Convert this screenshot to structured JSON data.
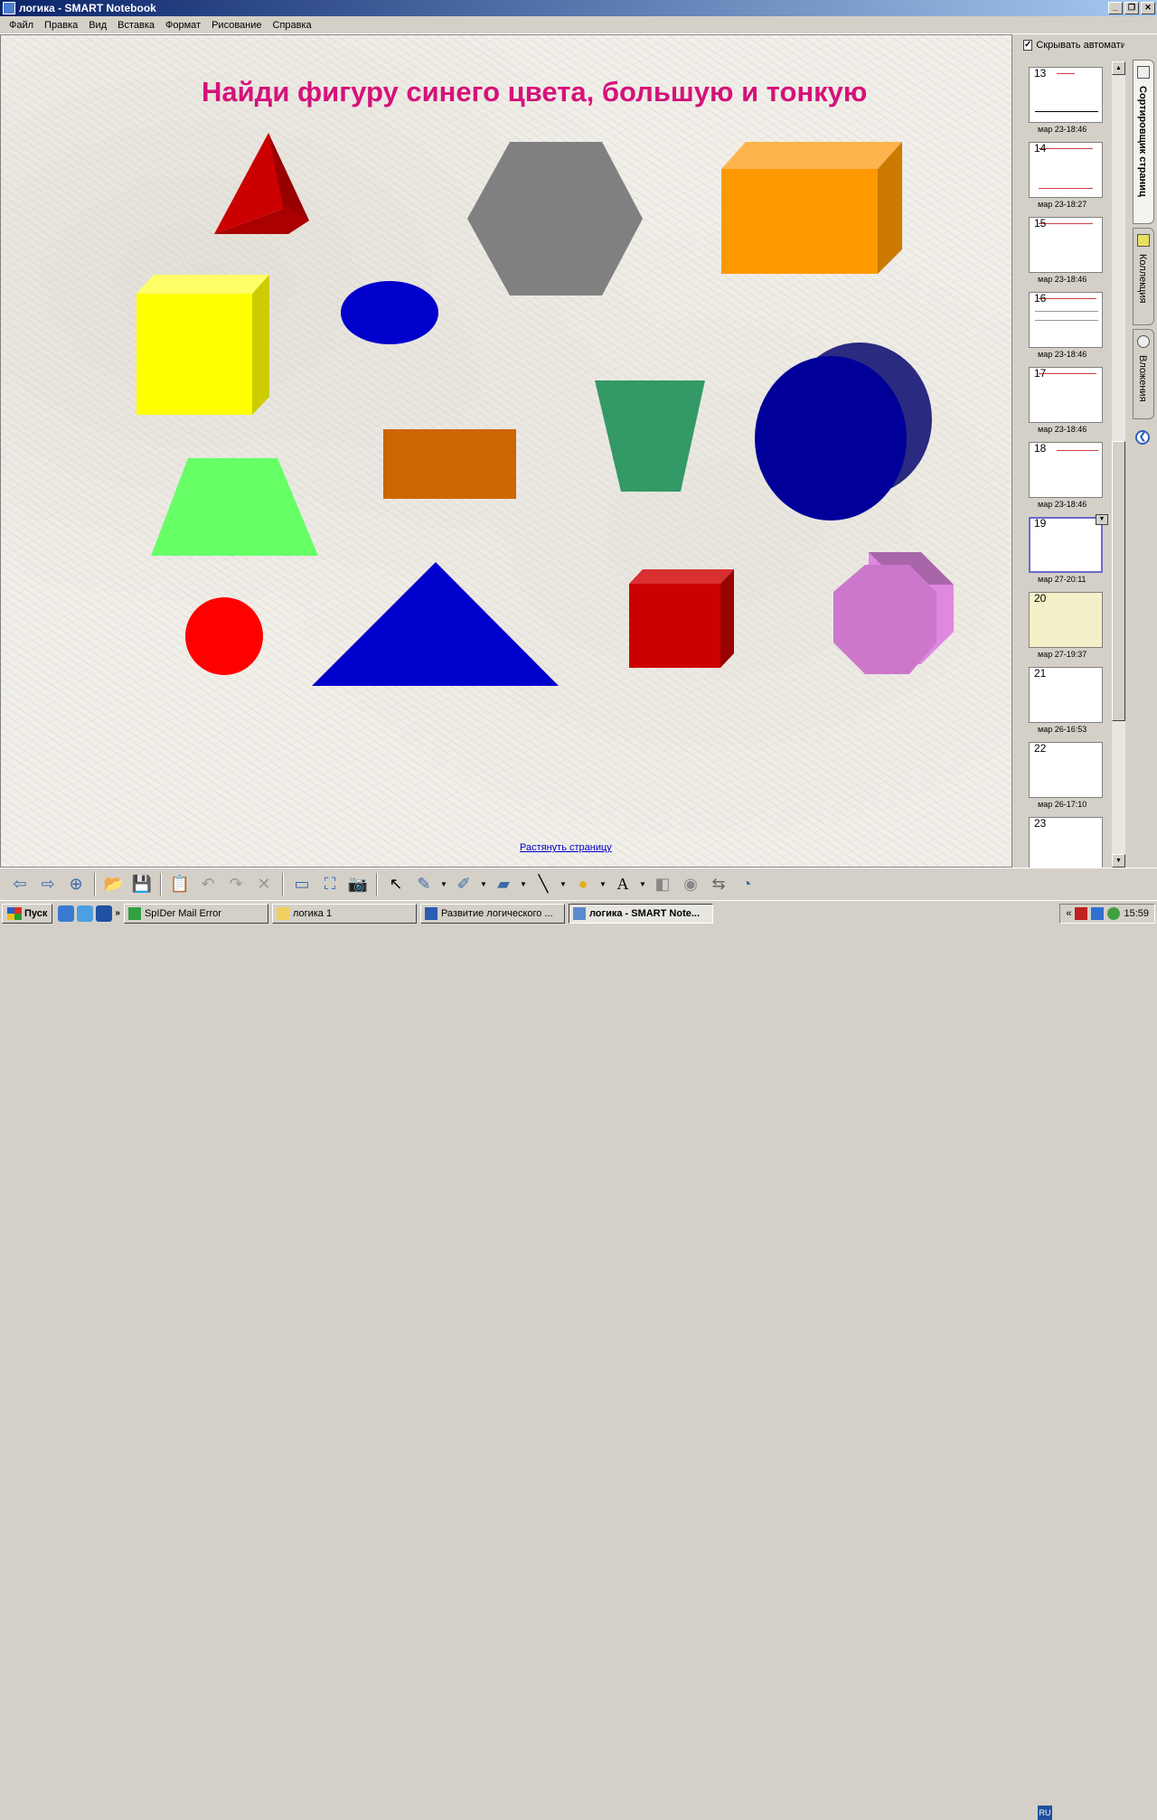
{
  "window": {
    "title": "логика - SMART Notebook"
  },
  "menu": [
    "Файл",
    "Правка",
    "Вид",
    "Вставка",
    "Формат",
    "Рисование",
    "Справка"
  ],
  "page": {
    "title": "Найди фигуру синего цвета, большую и тонкую",
    "stretch_link": "Растянуть страницу"
  },
  "shapes": [
    {
      "name": "red-pyramid",
      "color": "#cc0000"
    },
    {
      "name": "gray-hexagon",
      "color": "#808080"
    },
    {
      "name": "orange-box",
      "color": "#ff9900"
    },
    {
      "name": "yellow-cube",
      "color": "#ffff00"
    },
    {
      "name": "blue-ellipse",
      "color": "#0000cc"
    },
    {
      "name": "green-trapezoid-inverted",
      "color": "#339966"
    },
    {
      "name": "navy-cylinder",
      "color": "#000099"
    },
    {
      "name": "brown-rectangle",
      "color": "#cc6600"
    },
    {
      "name": "lightgreen-trapezoid",
      "color": "#66ff66"
    },
    {
      "name": "red-circle",
      "color": "#ff0000"
    },
    {
      "name": "blue-triangle",
      "color": "#0000cc"
    },
    {
      "name": "red-cube",
      "color": "#cc0000"
    },
    {
      "name": "violet-octagon-prism",
      "color": "#cc77cc"
    }
  ],
  "sorter": {
    "autohide_label": "Скрывать автоматически",
    "autohide_checked": true,
    "pages": [
      {
        "num": "13",
        "time": "мар 23-18:46"
      },
      {
        "num": "14",
        "time": "мар 23-18:27"
      },
      {
        "num": "15",
        "time": "мар 23-18:46"
      },
      {
        "num": "16",
        "time": "мар 23-18:46"
      },
      {
        "num": "17",
        "time": "мар 23-18:46"
      },
      {
        "num": "18",
        "time": "мар 23-18:46"
      },
      {
        "num": "19",
        "time": "мар 27-20:11",
        "selected": true
      },
      {
        "num": "20",
        "time": "мар 27-19:37"
      },
      {
        "num": "21",
        "time": "мар 26-16:53"
      },
      {
        "num": "22",
        "time": "мар 26-17:10"
      },
      {
        "num": "23",
        "time": ""
      }
    ]
  },
  "side_tabs": [
    "Сортировщик страниц",
    "Коллекция",
    "Вложения"
  ],
  "toolbar": [
    "prev-page-icon",
    "next-page-icon",
    "add-page-icon",
    "open-icon",
    "save-icon",
    "paste-icon",
    "undo-icon",
    "redo-icon",
    "delete-icon",
    "screen-shade-icon",
    "full-screen-icon",
    "capture-icon",
    "select-icon",
    "pen-icon",
    "highlighter-icon",
    "eraser-icon",
    "line-icon",
    "shape-icon",
    "text-icon",
    "fill-icon",
    "properties-icon",
    "move-toolbar-icon",
    "help-icon"
  ],
  "taskbar": {
    "start": "Пуск",
    "items": [
      {
        "label": "SpIDer Mail Error",
        "active": false
      },
      {
        "label": "логика 1",
        "active": false
      },
      {
        "label": "Развитие логического ...",
        "active": false
      },
      {
        "label": "логика - SMART Note...",
        "active": true
      }
    ],
    "lang": "RU",
    "clock": "15:59"
  }
}
